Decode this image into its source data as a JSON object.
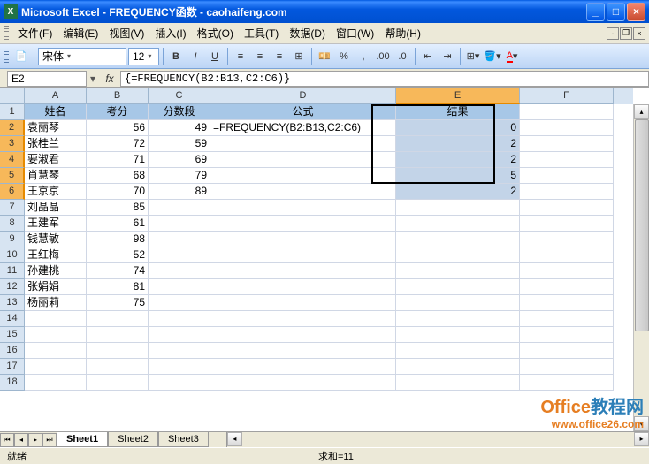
{
  "window": {
    "title": "Microsoft Excel - FREQUENCY函数 - caohaifeng.com"
  },
  "menus": {
    "file": "文件(F)",
    "edit": "编辑(E)",
    "view": "视图(V)",
    "insert": "插入(I)",
    "format": "格式(O)",
    "tools": "工具(T)",
    "data": "数据(D)",
    "window": "窗口(W)",
    "help": "帮助(H)"
  },
  "toolbar": {
    "font_name": "宋体",
    "font_size": "12"
  },
  "formula_bar": {
    "name_box": "E2",
    "formula": "{=FREQUENCY(B2:B13,C2:C6)}"
  },
  "columns": {
    "widths": [
      70,
      70,
      70,
      210,
      140,
      106
    ],
    "labels": [
      "A",
      "B",
      "C",
      "D",
      "E",
      "F"
    ]
  },
  "headers": {
    "c1": "姓名",
    "c2": "考分",
    "c3": "分数段",
    "c4": "公式",
    "c5": "结果"
  },
  "rows": [
    {
      "a": "袁丽琴",
      "b": "56",
      "c": "49",
      "d": "=FREQUENCY(B2:B13,C2:C6)",
      "e": "0"
    },
    {
      "a": "张桂兰",
      "b": "72",
      "c": "59",
      "d": "",
      "e": "2"
    },
    {
      "a": "要淑君",
      "b": "71",
      "c": "69",
      "d": "",
      "e": "2"
    },
    {
      "a": "肖慧琴",
      "b": "68",
      "c": "79",
      "d": "",
      "e": "5"
    },
    {
      "a": "王京京",
      "b": "70",
      "c": "89",
      "d": "",
      "e": "2"
    },
    {
      "a": "刘晶晶",
      "b": "85",
      "c": "",
      "d": "",
      "e": ""
    },
    {
      "a": "王建军",
      "b": "61",
      "c": "",
      "d": "",
      "e": ""
    },
    {
      "a": "钱慧敏",
      "b": "98",
      "c": "",
      "d": "",
      "e": ""
    },
    {
      "a": "王红梅",
      "b": "52",
      "c": "",
      "d": "",
      "e": ""
    },
    {
      "a": "孙建桃",
      "b": "74",
      "c": "",
      "d": "",
      "e": ""
    },
    {
      "a": "张娟娟",
      "b": "81",
      "c": "",
      "d": "",
      "e": ""
    },
    {
      "a": "杨丽莉",
      "b": "75",
      "c": "",
      "d": "",
      "e": ""
    }
  ],
  "sheets": {
    "s1": "Sheet1",
    "s2": "Sheet2",
    "s3": "Sheet3"
  },
  "status": {
    "ready": "就绪",
    "sum": "求和=11"
  },
  "watermark": {
    "brand_part1": "Office",
    "brand_part2": "教程网",
    "url": "www.office26.com"
  }
}
